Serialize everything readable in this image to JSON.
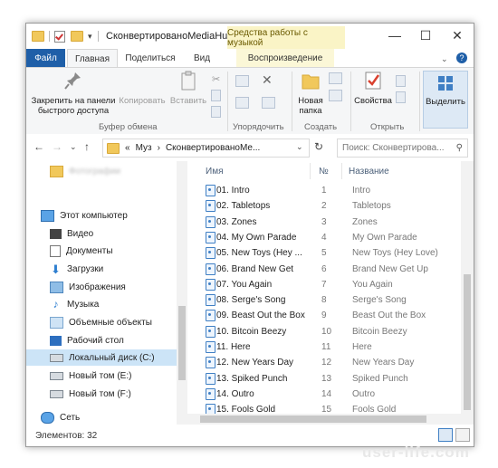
{
  "window": {
    "title": "СконвертированоMediaHu",
    "context_tab_group": "Средства работы с музыкой",
    "controls": {
      "minimize": "—",
      "maximize": "☐",
      "close": "✕"
    }
  },
  "ribbon_tabs": {
    "file": "Файл",
    "home": "Главная",
    "share": "Поделиться",
    "view": "Вид",
    "play": "Воспроизведение",
    "help": "?"
  },
  "ribbon": {
    "pin_label": "Закрепить на панели быстрого доступа",
    "copy_label": "Копировать",
    "paste_label": "Вставить",
    "clipboard_group": "Буфер обмена",
    "organize_group": "Упорядочить",
    "new_folder_label": "Новая папка",
    "create_group": "Создать",
    "properties_label": "Свойства",
    "open_group": "Открыть",
    "select_label": "Выделить"
  },
  "address": {
    "overflow": "«",
    "crumb1": "Муз",
    "sep": "›",
    "crumb2": "СконвертированоМе...",
    "search_placeholder": "Поиск: Сконвертирова..."
  },
  "nav": {
    "blurred": "Фотографии",
    "items": [
      "Этот компьютер",
      "Видео",
      "Документы",
      "Загрузки",
      "Изображения",
      "Музыка",
      "Объемные объекты",
      "Рабочий стол",
      "Локальный диск (C:)",
      "Новый том (E:)",
      "Новый том (F:)",
      "Сеть"
    ]
  },
  "list": {
    "columns": {
      "name": "Имя",
      "num": "№",
      "title": "Название"
    },
    "rows": [
      {
        "name": "01. Intro",
        "num": "1",
        "title": "Intro"
      },
      {
        "name": "02. Tabletops",
        "num": "2",
        "title": "Tabletops"
      },
      {
        "name": "03. Zones",
        "num": "3",
        "title": "Zones"
      },
      {
        "name": "04. My Own Parade",
        "num": "4",
        "title": "My Own Parade"
      },
      {
        "name": "05. New Toys (Hey ...",
        "num": "5",
        "title": "New Toys (Hey Love)"
      },
      {
        "name": "06. Brand New Get",
        "num": "6",
        "title": "Brand New Get Up"
      },
      {
        "name": "07. You Again",
        "num": "7",
        "title": "You Again"
      },
      {
        "name": "08. Serge's Song",
        "num": "8",
        "title": "Serge's Song"
      },
      {
        "name": "09. Beast Out the Box",
        "num": "9",
        "title": "Beast Out the Box"
      },
      {
        "name": "10. Bitcoin Beezy",
        "num": "10",
        "title": "Bitcoin Beezy"
      },
      {
        "name": "11. Here",
        "num": "11",
        "title": "Here"
      },
      {
        "name": "12. New Years Day",
        "num": "12",
        "title": "New Years Day"
      },
      {
        "name": "13. Spiked Punch",
        "num": "13",
        "title": "Spiked Punch"
      },
      {
        "name": "14. Outro",
        "num": "14",
        "title": "Outro"
      },
      {
        "name": "15. Fools Gold",
        "num": "15",
        "title": "Fools Gold"
      }
    ]
  },
  "status": {
    "count": "Элементов: 32"
  },
  "watermark": "user-life.com"
}
